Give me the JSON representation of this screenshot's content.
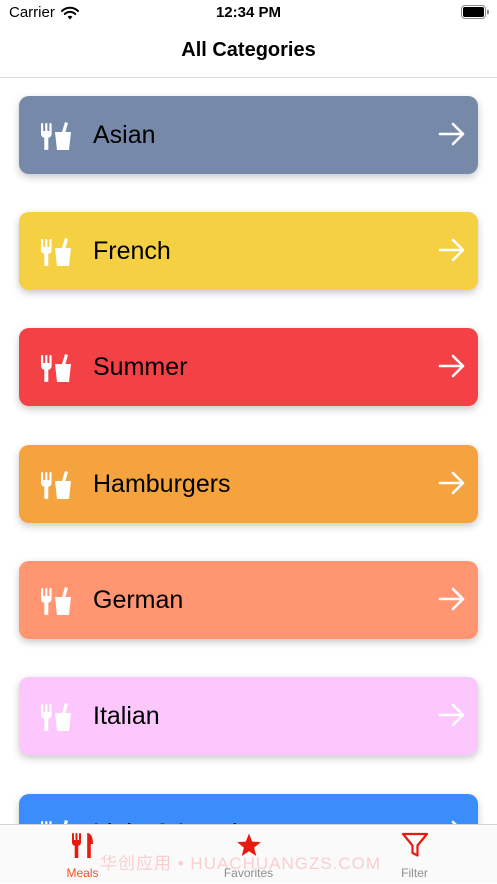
{
  "status_bar": {
    "carrier": "Carrier",
    "time": "12:34 PM"
  },
  "nav": {
    "title": "All Categories"
  },
  "categories": [
    {
      "label": "Asian",
      "color": "#7789A8"
    },
    {
      "label": "French",
      "color": "#F5D042"
    },
    {
      "label": "Summer",
      "color": "#F44146"
    },
    {
      "label": "Hamburgers",
      "color": "#F4A33F"
    },
    {
      "label": "German",
      "color": "#FF9671"
    },
    {
      "label": "Italian",
      "color": "#FBC7FD"
    },
    {
      "label": "Light & Lovely",
      "color": "#3A8DFB"
    }
  ],
  "tabs": [
    {
      "label": "Meals",
      "icon": "fork-knife-icon",
      "active": true
    },
    {
      "label": "Favorites",
      "icon": "star-icon",
      "active": false
    },
    {
      "label": "Filter",
      "icon": "filter-icon",
      "active": false
    }
  ],
  "colors": {
    "tab_active": "#F4511E",
    "tab_icon_red": "#E8190E",
    "tab_inactive_text": "#8e8e93"
  },
  "watermark": "华创应用 • HUACHUANGZS.COM"
}
